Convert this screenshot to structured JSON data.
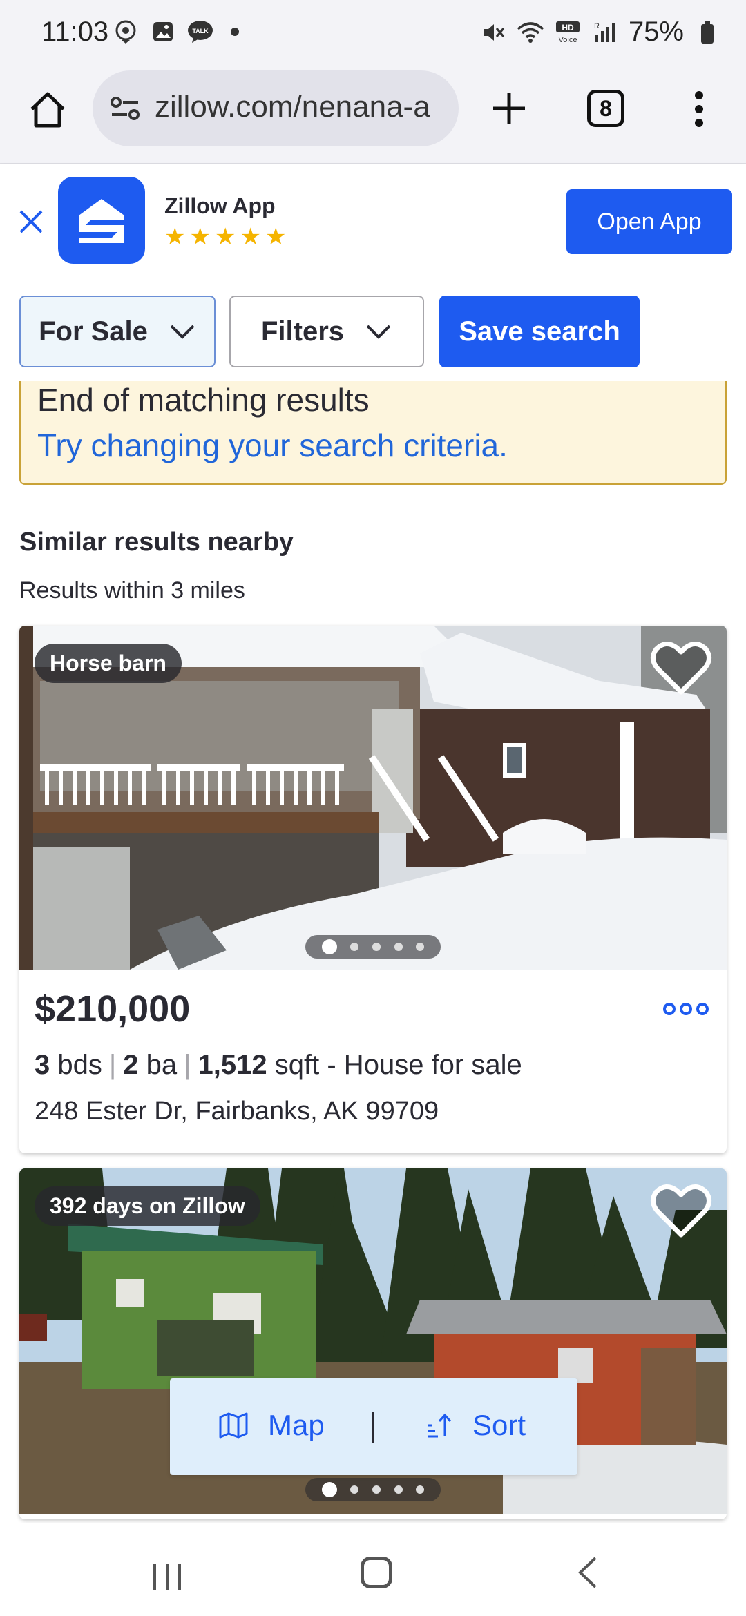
{
  "status_bar": {
    "time": "11:03",
    "battery": "75%"
  },
  "browser": {
    "url": "zillow.com/nenana-a",
    "tab_count": "8"
  },
  "app_banner": {
    "name": "Zillow App",
    "rating": 5,
    "open_label": "Open App"
  },
  "filters": {
    "for_sale_label": "For Sale",
    "filters_label": "Filters",
    "save_search_label": "Save search"
  },
  "notice": {
    "title": "End of matching results",
    "link": "Try changing your search criteria."
  },
  "section": {
    "title": "Similar results nearby",
    "subtitle": "Results within 3 miles"
  },
  "listings": [
    {
      "badge": "Horse barn",
      "price": "$210,000",
      "beds": "3",
      "beds_unit": "bds",
      "baths": "2",
      "baths_unit": "ba",
      "sqft": "1,512",
      "sqft_unit": "sqft",
      "type": "- House for sale",
      "address": "248 Ester Dr, Fairbanks, AK 99709",
      "photo_index": 1,
      "photo_count": 5
    },
    {
      "badge": "392 days on Zillow",
      "photo_index": 1,
      "photo_count": 5
    }
  ],
  "floating": {
    "map_label": "Map",
    "sort_label": "Sort"
  },
  "colors": {
    "brand_blue": "#1e5bf0",
    "link_blue": "#2166d9",
    "notice_bg": "#fdf5dd",
    "notice_border": "#c9a237",
    "star": "#f5b400"
  }
}
